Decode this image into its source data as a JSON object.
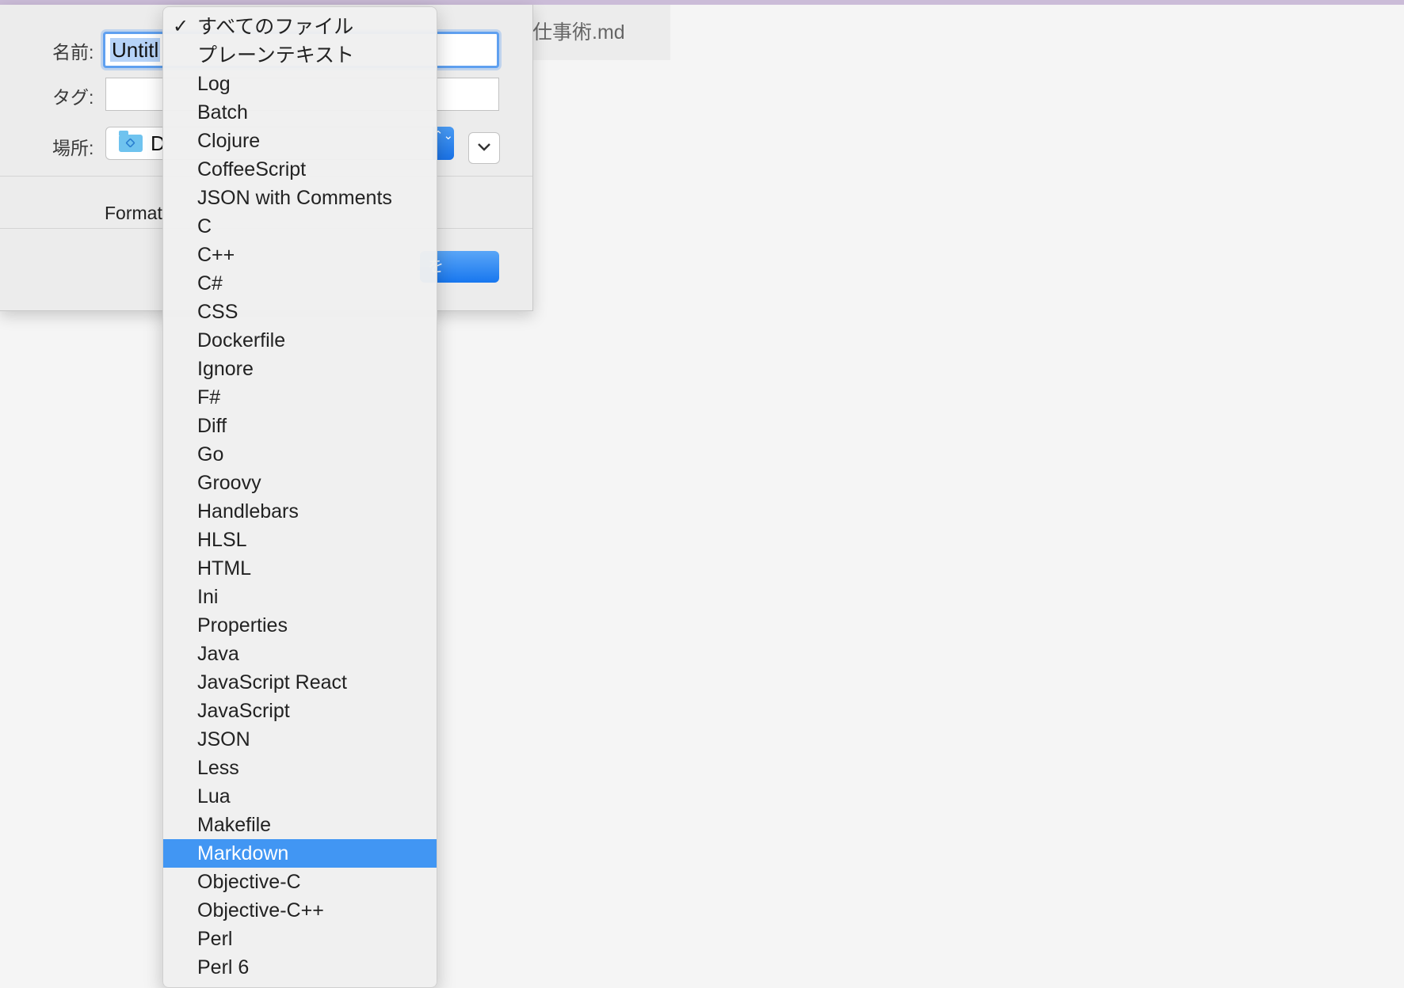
{
  "background_tab": {
    "title": "仕事術.md"
  },
  "dialog": {
    "name_label": "名前:",
    "name_value": "Untitl",
    "tags_label": "タグ:",
    "location_label": "場所:",
    "location_value": "D",
    "format_label": "Format",
    "save_label": "を",
    "stepper_glyph": "⌃⌄"
  },
  "menu": {
    "check_glyph": "✓",
    "items": [
      {
        "label": "すべてのファイル",
        "checked": true
      },
      {
        "label": "プレーンテキスト"
      },
      {
        "label": "Log"
      },
      {
        "label": "Batch"
      },
      {
        "label": "Clojure"
      },
      {
        "label": "CoffeeScript"
      },
      {
        "label": "JSON with Comments"
      },
      {
        "label": "C"
      },
      {
        "label": "C++"
      },
      {
        "label": "C#"
      },
      {
        "label": "CSS"
      },
      {
        "label": "Dockerfile"
      },
      {
        "label": "Ignore"
      },
      {
        "label": "F#"
      },
      {
        "label": "Diff"
      },
      {
        "label": "Go"
      },
      {
        "label": "Groovy"
      },
      {
        "label": "Handlebars"
      },
      {
        "label": "HLSL"
      },
      {
        "label": "HTML"
      },
      {
        "label": "Ini"
      },
      {
        "label": "Properties"
      },
      {
        "label": "Java"
      },
      {
        "label": "JavaScript React"
      },
      {
        "label": "JavaScript"
      },
      {
        "label": "JSON"
      },
      {
        "label": "Less"
      },
      {
        "label": "Lua"
      },
      {
        "label": "Makefile"
      },
      {
        "label": "Markdown",
        "highlighted": true
      },
      {
        "label": "Objective-C"
      },
      {
        "label": "Objective-C++"
      },
      {
        "label": "Perl"
      },
      {
        "label": "Perl 6"
      }
    ]
  },
  "colors": {
    "accent": "#4196f3",
    "top_bar": "#cbbcd8",
    "folder": "#6fc3ef"
  }
}
